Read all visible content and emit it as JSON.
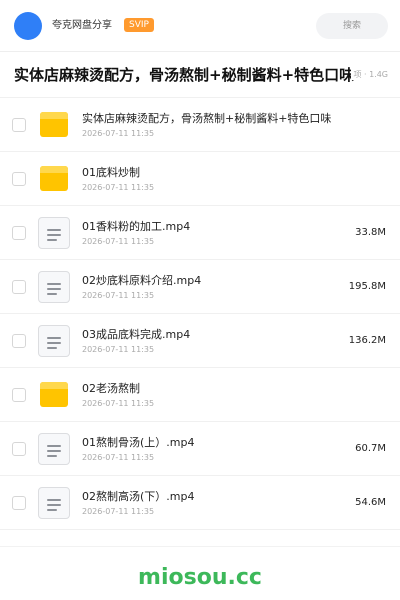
{
  "header": {
    "share_name": "夸克网盘分享",
    "badge": "SVIP",
    "search_placeholder": "搜索"
  },
  "folder": {
    "title": "实体店麻辣烫配方，骨汤熬制+秘制酱料+特色口味",
    "meta": "项 · 1.4G"
  },
  "files": [
    {
      "type": "folder",
      "name": "实体店麻辣烫配方，骨汤熬制+秘制酱料+特色口味",
      "date": "2026-07-11 11:35",
      "size": ""
    },
    {
      "type": "folder",
      "name": "01底料炒制",
      "date": "2026-07-11 11:35",
      "size": ""
    },
    {
      "type": "file",
      "name": "01香料粉的加工.mp4",
      "date": "2026-07-11 11:35",
      "size": "33.8M"
    },
    {
      "type": "file",
      "name": "02炒底料原料介绍.mp4",
      "date": "2026-07-11 11:35",
      "size": "195.8M"
    },
    {
      "type": "file",
      "name": "03成品底料完成.mp4",
      "date": "2026-07-11 11:35",
      "size": "136.2M"
    },
    {
      "type": "folder",
      "name": "02老汤熬制",
      "date": "2026-07-11 11:35",
      "size": ""
    },
    {
      "type": "file",
      "name": "01熬制骨汤(上）.mp4",
      "date": "2026-07-11 11:35",
      "size": "60.7M"
    },
    {
      "type": "file",
      "name": "02熬制高汤(下）.mp4",
      "date": "2026-07-11 11:35",
      "size": "54.6M"
    }
  ],
  "watermark": "miosou.cc",
  "colors": {
    "avatar": "#2f7ff7",
    "badge": "#ff9a2e",
    "folder": "#ffc400",
    "watermark": "#3db85a"
  }
}
